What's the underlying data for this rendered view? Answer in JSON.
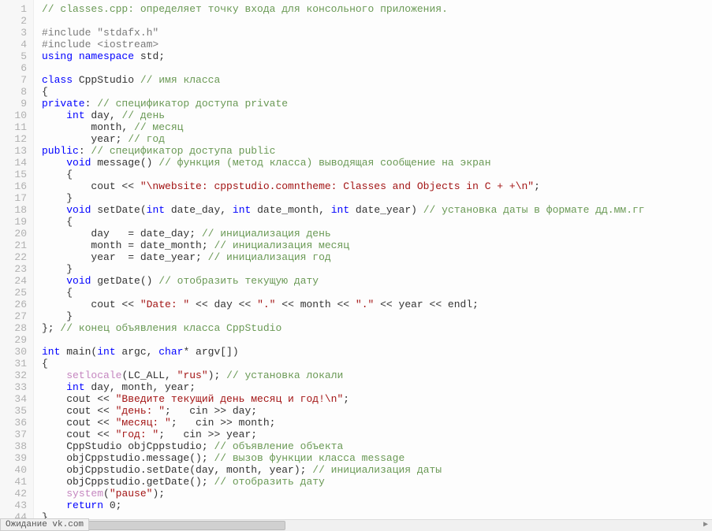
{
  "status_text": "Ожидание vk.com",
  "lines": [
    {
      "n": 1,
      "tokens": [
        [
          "c-comment",
          "// classes.cpp: определяет точку входа для консольного приложения."
        ]
      ]
    },
    {
      "n": 2,
      "tokens": []
    },
    {
      "n": 3,
      "tokens": [
        [
          "c-pp",
          "#include \"stdafx.h\""
        ]
      ]
    },
    {
      "n": 4,
      "tokens": [
        [
          "c-pp",
          "#include <iostream>"
        ]
      ]
    },
    {
      "n": 5,
      "tokens": [
        [
          "c-kw",
          "using"
        ],
        [
          "",
          " "
        ],
        [
          "c-kw",
          "namespace"
        ],
        [
          "",
          " std;"
        ]
      ]
    },
    {
      "n": 6,
      "tokens": []
    },
    {
      "n": 7,
      "tokens": [
        [
          "c-kw",
          "class"
        ],
        [
          "",
          " CppStudio "
        ],
        [
          "c-comment",
          "// имя класса"
        ]
      ]
    },
    {
      "n": 8,
      "tokens": [
        [
          "",
          "{"
        ]
      ]
    },
    {
      "n": 9,
      "tokens": [
        [
          "c-kw",
          "private"
        ],
        [
          "",
          ": "
        ],
        [
          "c-comment",
          "// спецификатор доступа private"
        ]
      ]
    },
    {
      "n": 10,
      "tokens": [
        [
          "",
          "    "
        ],
        [
          "c-kw",
          "int"
        ],
        [
          "",
          " day, "
        ],
        [
          "c-comment",
          "// день"
        ]
      ]
    },
    {
      "n": 11,
      "tokens": [
        [
          "",
          "        month, "
        ],
        [
          "c-comment",
          "// месяц"
        ]
      ]
    },
    {
      "n": 12,
      "tokens": [
        [
          "",
          "        year; "
        ],
        [
          "c-comment",
          "// год"
        ]
      ]
    },
    {
      "n": 13,
      "tokens": [
        [
          "c-kw",
          "public"
        ],
        [
          "",
          ": "
        ],
        [
          "c-comment",
          "// спецификатор доступа public"
        ]
      ]
    },
    {
      "n": 14,
      "tokens": [
        [
          "",
          "    "
        ],
        [
          "c-kw",
          "void"
        ],
        [
          "",
          " message() "
        ],
        [
          "c-comment",
          "// функция (метод класса) выводящая сообщение на экран"
        ]
      ]
    },
    {
      "n": 15,
      "tokens": [
        [
          "",
          "    {"
        ]
      ]
    },
    {
      "n": 16,
      "tokens": [
        [
          "",
          "        cout << "
        ],
        [
          "c-str",
          "\"\\nwebsite: cppstudio.comntheme: Classes and Objects in C + +\\n\""
        ],
        [
          "",
          ";"
        ]
      ]
    },
    {
      "n": 17,
      "tokens": [
        [
          "",
          "    }"
        ]
      ]
    },
    {
      "n": 18,
      "tokens": [
        [
          "",
          "    "
        ],
        [
          "c-kw",
          "void"
        ],
        [
          "",
          " setDate("
        ],
        [
          "c-kw",
          "int"
        ],
        [
          "",
          " date_day, "
        ],
        [
          "c-kw",
          "int"
        ],
        [
          "",
          " date_month, "
        ],
        [
          "c-kw",
          "int"
        ],
        [
          "",
          " date_year) "
        ],
        [
          "c-comment",
          "// установка даты в формате дд.мм.гг"
        ]
      ]
    },
    {
      "n": 19,
      "tokens": [
        [
          "",
          "    {"
        ]
      ]
    },
    {
      "n": 20,
      "tokens": [
        [
          "",
          "        day   = date_day; "
        ],
        [
          "c-comment",
          "// инициализация день"
        ]
      ]
    },
    {
      "n": 21,
      "tokens": [
        [
          "",
          "        month = date_month; "
        ],
        [
          "c-comment",
          "// инициализация месяц"
        ]
      ]
    },
    {
      "n": 22,
      "tokens": [
        [
          "",
          "        year  = date_year; "
        ],
        [
          "c-comment",
          "// инициализация год"
        ]
      ]
    },
    {
      "n": 23,
      "tokens": [
        [
          "",
          "    }"
        ]
      ]
    },
    {
      "n": 24,
      "tokens": [
        [
          "",
          "    "
        ],
        [
          "c-kw",
          "void"
        ],
        [
          "",
          " getDate() "
        ],
        [
          "c-comment",
          "// отобразить текущую дату"
        ]
      ]
    },
    {
      "n": 25,
      "tokens": [
        [
          "",
          "    {"
        ]
      ]
    },
    {
      "n": 26,
      "tokens": [
        [
          "",
          "        cout << "
        ],
        [
          "c-str",
          "\"Date: \""
        ],
        [
          "",
          " << day << "
        ],
        [
          "c-str",
          "\".\""
        ],
        [
          "",
          " << month << "
        ],
        [
          "c-str",
          "\".\""
        ],
        [
          "",
          " << year << endl;"
        ]
      ]
    },
    {
      "n": 27,
      "tokens": [
        [
          "",
          "    }"
        ]
      ]
    },
    {
      "n": 28,
      "tokens": [
        [
          "",
          "}; "
        ],
        [
          "c-comment",
          "// конец объявления класса CppStudio"
        ]
      ]
    },
    {
      "n": 29,
      "tokens": []
    },
    {
      "n": 30,
      "tokens": [
        [
          "c-kw",
          "int"
        ],
        [
          "",
          " main("
        ],
        [
          "c-kw",
          "int"
        ],
        [
          "",
          " argc, "
        ],
        [
          "c-kw",
          "char"
        ],
        [
          "",
          "* argv[])"
        ]
      ]
    },
    {
      "n": 31,
      "tokens": [
        [
          "",
          "{"
        ]
      ]
    },
    {
      "n": 32,
      "tokens": [
        [
          "",
          "    "
        ],
        [
          "c-special",
          "setlocale"
        ],
        [
          "",
          "(LC_ALL, "
        ],
        [
          "c-str",
          "\"rus\""
        ],
        [
          "",
          "); "
        ],
        [
          "c-comment",
          "// установка локали"
        ]
      ]
    },
    {
      "n": 33,
      "tokens": [
        [
          "",
          "    "
        ],
        [
          "c-kw",
          "int"
        ],
        [
          "",
          " day, month, year;"
        ]
      ]
    },
    {
      "n": 34,
      "tokens": [
        [
          "",
          "    cout << "
        ],
        [
          "c-str",
          "\"Введите текущий день месяц и год!\\n\""
        ],
        [
          "",
          ";"
        ]
      ]
    },
    {
      "n": 35,
      "tokens": [
        [
          "",
          "    cout << "
        ],
        [
          "c-str",
          "\"день: \""
        ],
        [
          "",
          ";   cin >> day;"
        ]
      ]
    },
    {
      "n": 36,
      "tokens": [
        [
          "",
          "    cout << "
        ],
        [
          "c-str",
          "\"месяц: \""
        ],
        [
          "",
          ";   cin >> month;"
        ]
      ]
    },
    {
      "n": 37,
      "tokens": [
        [
          "",
          "    cout << "
        ],
        [
          "c-str",
          "\"год: \""
        ],
        [
          "",
          ";   cin >> year;"
        ]
      ]
    },
    {
      "n": 38,
      "tokens": [
        [
          "",
          "    CppStudio objCppstudio; "
        ],
        [
          "c-comment",
          "// объявление объекта"
        ]
      ]
    },
    {
      "n": 39,
      "tokens": [
        [
          "",
          "    objCppstudio.message(); "
        ],
        [
          "c-comment",
          "// вызов функции класса message"
        ]
      ]
    },
    {
      "n": 40,
      "tokens": [
        [
          "",
          "    objCppstudio.setDate(day, month, year); "
        ],
        [
          "c-comment",
          "// инициализация даты"
        ]
      ]
    },
    {
      "n": 41,
      "tokens": [
        [
          "",
          "    objCppstudio.getDate(); "
        ],
        [
          "c-comment",
          "// отобразить дату"
        ]
      ]
    },
    {
      "n": 42,
      "tokens": [
        [
          "",
          "    "
        ],
        [
          "c-special",
          "system"
        ],
        [
          "",
          "("
        ],
        [
          "c-str",
          "\"pause\""
        ],
        [
          "",
          ");"
        ]
      ]
    },
    {
      "n": 43,
      "tokens": [
        [
          "",
          "    "
        ],
        [
          "c-kw",
          "return"
        ],
        [
          "",
          " 0;"
        ]
      ]
    },
    {
      "n": 44,
      "tokens": [
        [
          "",
          "}"
        ]
      ]
    }
  ]
}
